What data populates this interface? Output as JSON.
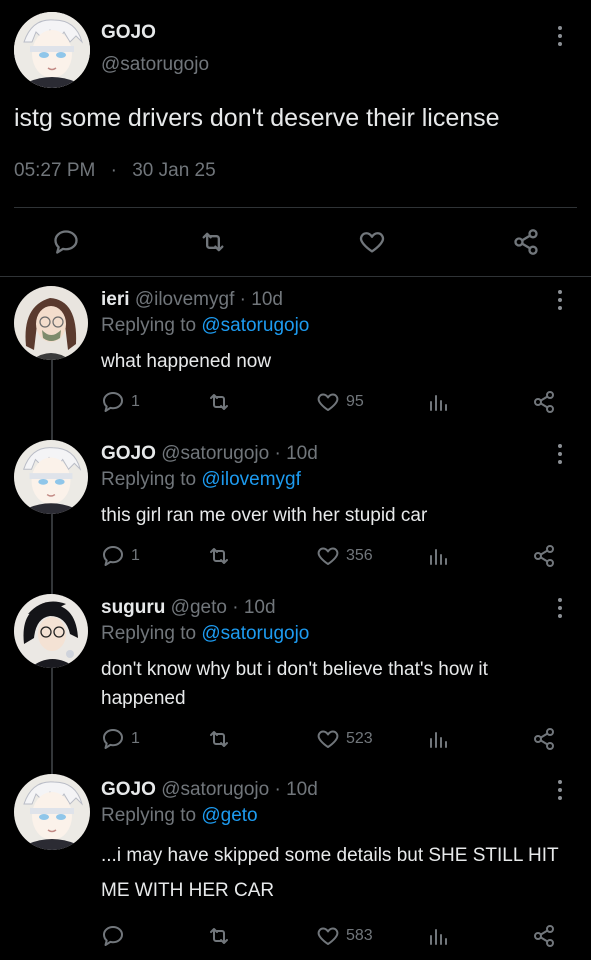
{
  "main_tweet": {
    "name": "GOJO",
    "handle": "@satorugojo",
    "text": "istg some drivers don't deserve their license",
    "time": "05:27 PM",
    "separator": "·",
    "date": "30 Jan 25"
  },
  "replies": [
    {
      "name": "ieri",
      "handle": "@ilovemygf",
      "age": "· 10d",
      "replying_prefix": "Replying to",
      "replying_to": "@satorugojo",
      "text": "what happened now",
      "reply_count": "1",
      "like_count": "95"
    },
    {
      "name": "GOJO",
      "handle": "@satorugojo",
      "age": "· 10d",
      "replying_prefix": "Replying to",
      "replying_to": "@ilovemygf",
      "text": "this girl ran me over with her stupid car",
      "reply_count": "1",
      "like_count": "356"
    },
    {
      "name": "suguru",
      "handle": "@geto",
      "age": "· 10d",
      "replying_prefix": "Replying to",
      "replying_to": "@satorugojo",
      "text": "don't know why but i don't believe that's how it happened",
      "reply_count": "1",
      "like_count": "523"
    },
    {
      "name": "GOJO",
      "handle": "@satorugojo",
      "age": "· 10d",
      "replying_prefix": "Replying to",
      "replying_to": "@geto",
      "text": "...i may have skipped some details but SHE STILL HIT ME WITH HER CAR",
      "reply_count": "",
      "like_count": "583"
    }
  ],
  "colors": {
    "background": "#000000",
    "text": "#e7e9ea",
    "muted": "#71767b",
    "link": "#1d9bf0",
    "divider": "#2f3336"
  }
}
